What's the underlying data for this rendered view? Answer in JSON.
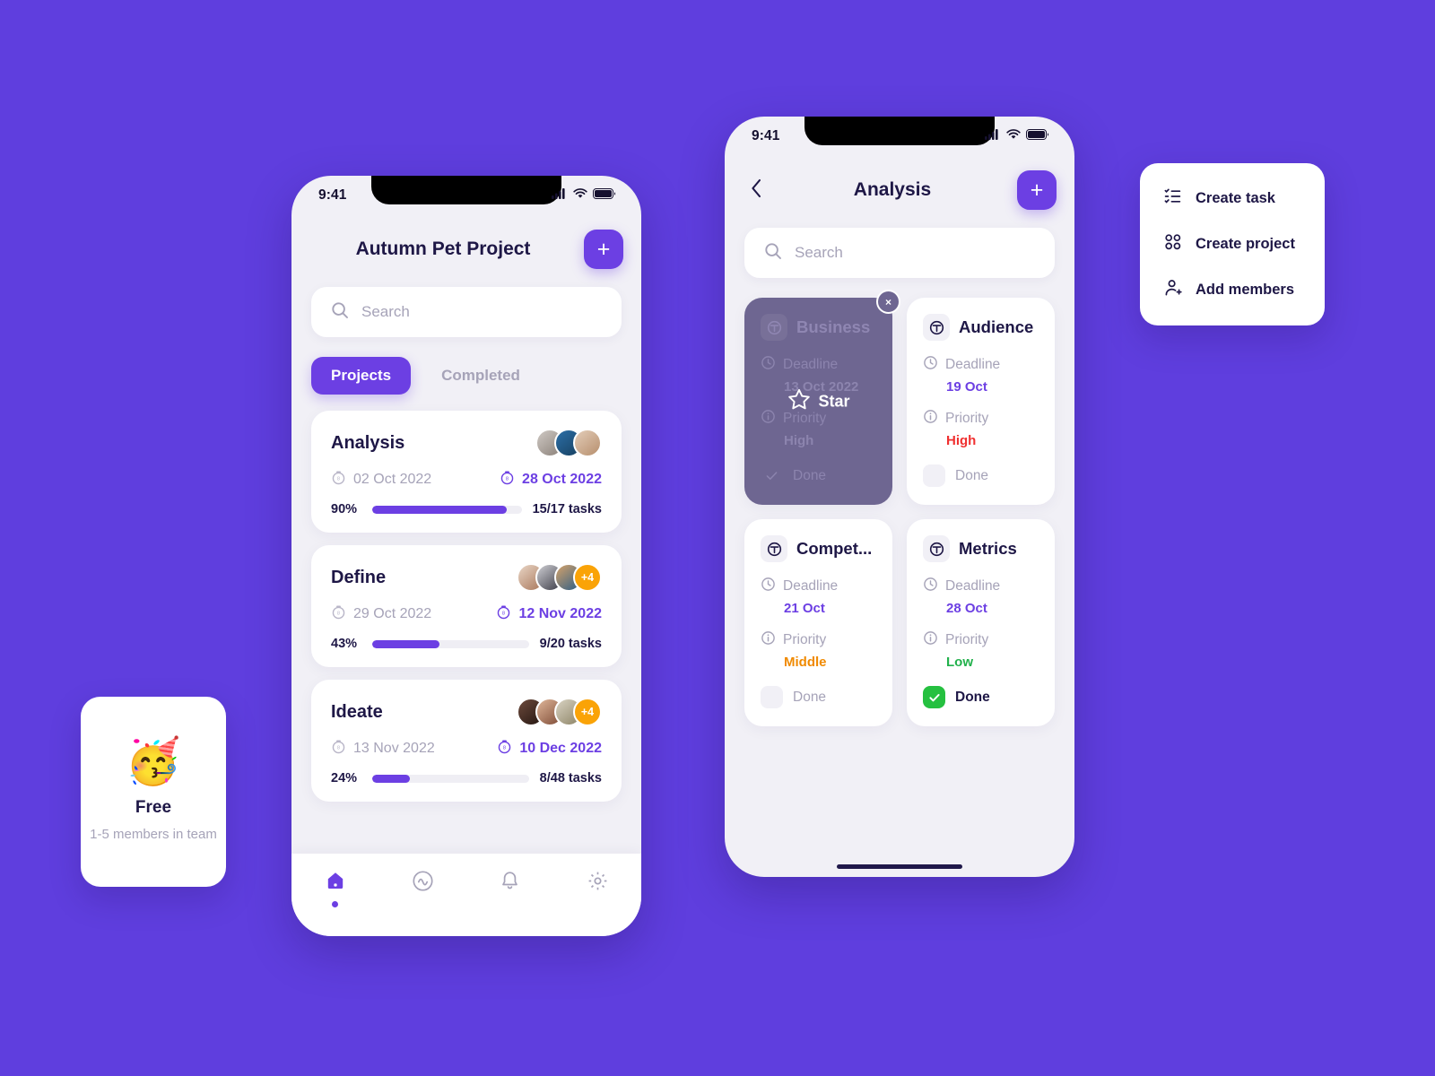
{
  "canvas": {
    "background_color": "#5F3EDE",
    "accent_color": "#6C3FE3"
  },
  "phone_left": {
    "status": {
      "time": "9:41",
      "signal_icon": "signal-bars-icon",
      "wifi_icon": "wifi-icon",
      "battery_icon": "battery-icon"
    },
    "header": {
      "title": "Autumn Pet Project",
      "add_label": "+"
    },
    "search": {
      "placeholder": "Search",
      "icon": "search-icon"
    },
    "tabs": [
      {
        "label": "Projects",
        "active": true
      },
      {
        "label": "Completed",
        "active": false
      }
    ],
    "projects": [
      {
        "name": "Analysis",
        "start_date": "02 Oct 2022",
        "end_date": "28 Oct 2022",
        "percent": "90%",
        "progress": 90,
        "tasks": "15/17 tasks",
        "extra_members": null
      },
      {
        "name": "Define",
        "start_date": "29 Oct 2022",
        "end_date": "12 Nov 2022",
        "percent": "43%",
        "progress": 43,
        "tasks": "9/20 tasks",
        "extra_members": "+4"
      },
      {
        "name": "Ideate",
        "start_date": "13 Nov 2022",
        "end_date": "10 Dec 2022",
        "percent": "24%",
        "progress": 24,
        "tasks": "8/48 tasks",
        "extra_members": "+4"
      }
    ],
    "bottom_nav": [
      {
        "icon": "home-icon",
        "active": true
      },
      {
        "icon": "activity-circle-icon",
        "active": false
      },
      {
        "icon": "bell-icon",
        "active": false
      },
      {
        "icon": "gear-icon",
        "active": false
      }
    ]
  },
  "phone_right": {
    "status": {
      "time": "9:41",
      "signal_icon": "signal-bars-icon",
      "wifi_icon": "wifi-icon",
      "battery_icon": "battery-icon"
    },
    "header": {
      "title": "Analysis",
      "back_icon": "chevron-left-icon",
      "add_label": "+"
    },
    "search": {
      "placeholder": "Search",
      "icon": "search-icon"
    },
    "labels": {
      "deadline": "Deadline",
      "priority": "Priority",
      "done": "Done"
    },
    "tasks": [
      {
        "name": "Business",
        "deadline": "13 Oct 2022",
        "priority": "High",
        "priority_class": "v-high",
        "done": false,
        "state": "dimmed",
        "overlay_action": "Star",
        "close_label": "×"
      },
      {
        "name": "Audience",
        "deadline": "19 Oct",
        "priority": "High",
        "priority_class": "v-high",
        "done": false,
        "state": "normal"
      },
      {
        "name": "Compet...",
        "deadline": "21 Oct",
        "priority": "Middle",
        "priority_class": "v-middle",
        "done": false,
        "state": "normal"
      },
      {
        "name": "Metrics",
        "deadline": "28 Oct",
        "priority": "Low",
        "priority_class": "v-low",
        "done": true,
        "state": "normal"
      }
    ]
  },
  "context_menu": {
    "items": [
      {
        "label": "Create task",
        "icon": "checklist-icon"
      },
      {
        "label": "Create project",
        "icon": "grid-four-icon"
      },
      {
        "label": "Add members",
        "icon": "person-add-icon"
      }
    ]
  },
  "free_card": {
    "emoji": "🥳",
    "title": "Free",
    "subtitle": "1-5 members\nin team"
  }
}
